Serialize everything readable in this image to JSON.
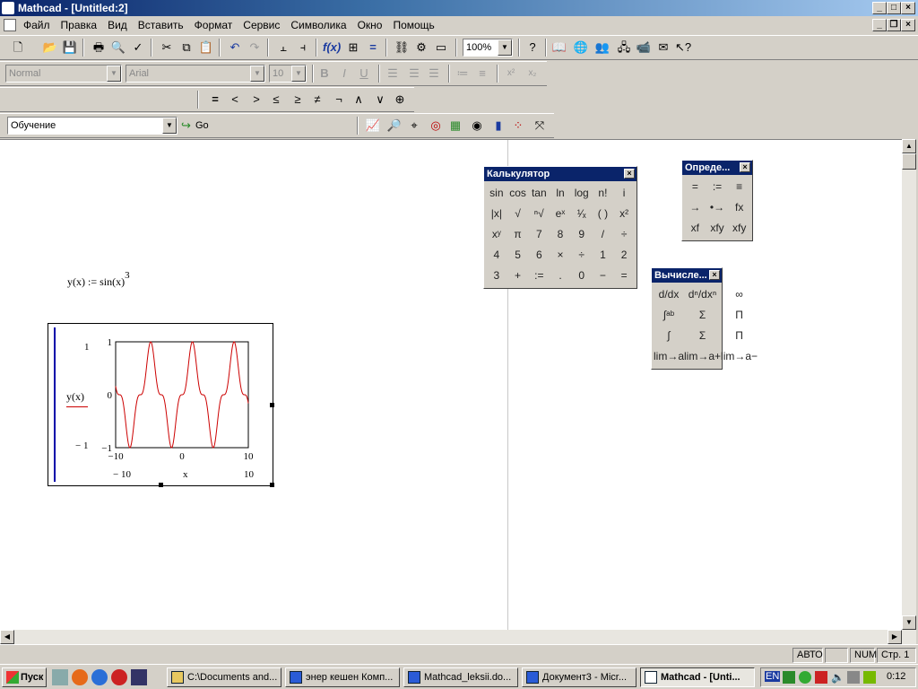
{
  "window": {
    "title": "Mathcad - [Untitled:2]"
  },
  "menu": [
    "Файл",
    "Правка",
    "Вид",
    "Вставить",
    "Формат",
    "Сервис",
    "Символика",
    "Окно",
    "Помощь"
  ],
  "toolbar": {
    "zoom": "100%"
  },
  "format_bar": {
    "style": "Normal",
    "font": "Arial",
    "size": "10"
  },
  "math_bar": {
    "symbols": [
      "=",
      "<",
      ">",
      "≤",
      "≥",
      "≠",
      "¬",
      "∧",
      "∨",
      "⊕"
    ]
  },
  "resources": {
    "value": "Обучение",
    "go_label": "Go"
  },
  "worksheet": {
    "definition": "y(x) := sin(x)",
    "definition_exponent": "3"
  },
  "plot": {
    "ylabel": "y(x)",
    "xlabel": "x",
    "y_top_label": "1",
    "y_bottom_label": "− 1",
    "x_left_label": "− 10",
    "x_right_label": "10",
    "y_ticks": [
      "1",
      "0",
      "−1"
    ],
    "x_ticks": [
      "−10",
      "0",
      "10"
    ]
  },
  "chart_data": {
    "type": "line",
    "function": "sin(x)^3",
    "series": [
      {
        "name": "y(x)",
        "color": "#cc0000"
      }
    ],
    "xlim": [
      -10,
      10
    ],
    "ylim": [
      -1,
      1
    ],
    "xlabel": "x",
    "ylabel": "y(x)",
    "grid": false
  },
  "palettes": {
    "calculator": {
      "title": "Калькулятор",
      "buttons": [
        "sin",
        "cos",
        "tan",
        "ln",
        "log",
        "n!",
        "i",
        "|x|",
        "√",
        "ⁿ√",
        "eˣ",
        "¹⁄ₓ",
        "( )",
        "x²",
        "xʸ",
        "π",
        "7",
        "8",
        "9",
        "/",
        "÷",
        "4",
        "5",
        "6",
        "×",
        "÷",
        "1",
        "2",
        "3",
        "+",
        ":=",
        ".",
        "0",
        "−",
        "="
      ]
    },
    "definition": {
      "title": "Опреде...",
      "buttons": [
        "=",
        ":=",
        "≡",
        "→",
        "•→",
        "fx",
        "xf",
        "xfy",
        "xfy"
      ]
    },
    "calculus": {
      "title": "Вычисле...",
      "buttons": [
        "d/dx",
        "dⁿ/dxⁿ",
        "∞",
        "∫ᵃᵇ",
        "Σ",
        "Π",
        "∫",
        "Σ",
        "Π",
        "lim→a",
        "lim→a+",
        "lim→a−"
      ]
    }
  },
  "statusbar": {
    "mode": "АВТО",
    "num": "NUM",
    "page": "Стр. 1"
  },
  "taskbar": {
    "start": "Пуск",
    "tasks": [
      "C:\\Documents and...",
      "энер кешен Комп...",
      "Mathcad_leksii.do...",
      "Документ3 - Micr...",
      "Mathcad - [Unti..."
    ],
    "lang": "EN",
    "clock": "0:12"
  },
  "colors": {
    "titlebar": "#0a246a",
    "plot_line": "#cc0000",
    "axis_bar": "#0000aa"
  }
}
